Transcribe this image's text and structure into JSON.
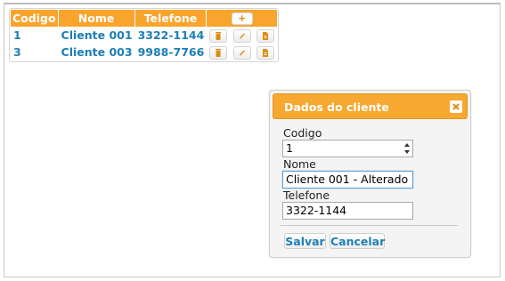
{
  "table": {
    "headers": {
      "codigo": "Codigo",
      "nome": "Nome",
      "telefone": "Telefone",
      "add": "+"
    },
    "rows": [
      {
        "codigo": "1",
        "nome": "Cliente 001",
        "telefone": "3322-1144"
      },
      {
        "codigo": "3",
        "nome": "Cliente 003",
        "telefone": "9988-7766"
      }
    ],
    "row_actions": [
      "trash-icon",
      "pencil-icon",
      "document-icon"
    ]
  },
  "dialog": {
    "title": "Dados do cliente",
    "close_icon": "close-icon",
    "fields": {
      "codigo_label": "Codigo",
      "codigo_value": "1",
      "nome_label": "Nome",
      "nome_value": "Cliente 001 - Alterado",
      "telefone_label": "Telefone",
      "telefone_value": "3322-1144"
    },
    "save_label": "Salvar",
    "cancel_label": "Cancelar"
  },
  "colors": {
    "accent": "#f9a42c",
    "link": "#1d7fb5"
  }
}
